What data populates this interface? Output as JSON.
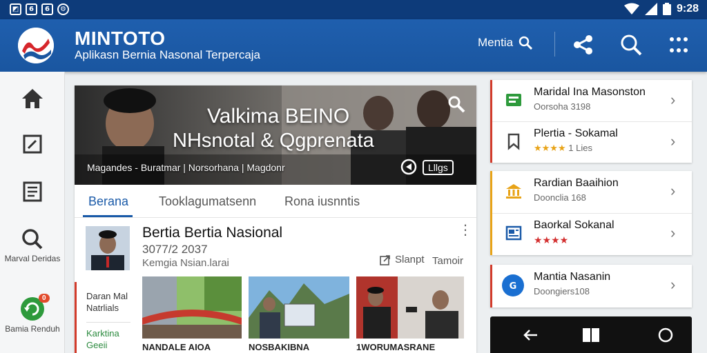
{
  "status_bar": {
    "time": "9:28"
  },
  "app": {
    "title": "MINTOTO",
    "subtitle": "Aplikasn Bernia Nasonal Terpercaja",
    "search_label": "Mentia"
  },
  "left_rail": {
    "items": [
      {
        "icon": "home-icon",
        "label": ""
      },
      {
        "icon": "edit-icon",
        "label": ""
      },
      {
        "icon": "document-icon",
        "label": ""
      },
      {
        "icon": "search-icon",
        "label": "Marval Deridas"
      },
      {
        "icon": "refresh-icon",
        "label": "Bamia Renduh",
        "badge": "0"
      }
    ]
  },
  "hero": {
    "title_line1": "Valkima BEINO",
    "title_line2": "NHsnotal & Qgprenata",
    "meta": "Magandes - Buratmar | Norsorhana | Magdonr",
    "tag": "Lllgs"
  },
  "tabs": [
    {
      "label": "Berana",
      "active": true
    },
    {
      "label": "Tooklagumatsenn",
      "active": false
    },
    {
      "label": "Rona iusnntis",
      "active": false
    }
  ],
  "article": {
    "title": "Bertia Bertia Nasional",
    "date": "3077/2 2037",
    "source": "Kemgia Nsian.larai",
    "share_label": "Slanpt",
    "time_label": "Tamoir"
  },
  "side_list": {
    "item1": "Daran Mal Natrlials",
    "item2": "Karktina Geeii"
  },
  "photos": [
    {
      "caption": "NANDALE AIOA"
    },
    {
      "caption": "NOSBAKIBNA"
    },
    {
      "caption": "1WORUMASRANE"
    }
  ],
  "right_cards": [
    {
      "rows": [
        {
          "icon": "news-icon",
          "title": "Maridal Ina Masonston",
          "subtitle": "Oorsoha 3198"
        },
        {
          "icon": "bookmark-icon",
          "title": "Plertia - Sokamal",
          "rating_text": "1 Lies",
          "stars": "★★★★"
        }
      ]
    },
    {
      "rows": [
        {
          "icon": "bank-icon",
          "title": "Rardian Baaihion",
          "subtitle": "Doonclia 168"
        },
        {
          "icon": "article-icon",
          "title": "Baorkal Sokanal",
          "stars": "★★★★"
        }
      ]
    },
    {
      "rows": [
        {
          "icon": "globe-icon",
          "title": "Mantia Nasanin",
          "subtitle": "Doongiers108"
        }
      ]
    }
  ],
  "colors": {
    "primary": "#1a56a0",
    "status_bar": "#0d3b7a",
    "accent_red": "#d23b2b",
    "tab_active": "#1a5aa8"
  }
}
